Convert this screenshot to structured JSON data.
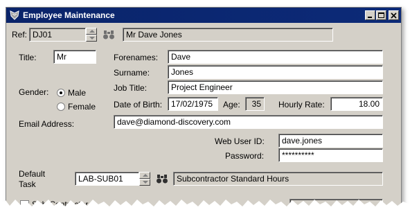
{
  "window": {
    "title": "Employee Maintenance"
  },
  "ref": {
    "label": "Ref:",
    "code": "DJ01",
    "name": "Mr Dave Jones"
  },
  "title": {
    "label": "Title:",
    "value": "Mr"
  },
  "forenames": {
    "label": "Forenames:",
    "value": "Dave"
  },
  "surname": {
    "label": "Surname:",
    "value": "Jones"
  },
  "job_title": {
    "label": "Job Title:",
    "value": "Project Engineer"
  },
  "gender": {
    "label": "Gender:",
    "options": [
      "Male",
      "Female"
    ],
    "selected": "Male"
  },
  "dob": {
    "label": "Date of Birth:",
    "value": "17/02/1975"
  },
  "age": {
    "label": "Age:",
    "value": "35"
  },
  "hourly_rate": {
    "label": "Hourly Rate:",
    "value": "18.00"
  },
  "email": {
    "label": "Email Address:",
    "value": "dave@diamond-discovery.com"
  },
  "web_user": {
    "label": "Web User ID:",
    "value": "dave.jones"
  },
  "password": {
    "label": "Password:",
    "value": "**********"
  },
  "default_task": {
    "label_line1": "Default",
    "label_line2": "Task",
    "code": "LAB-SUB01",
    "description": "Subcontractor Standard Hours"
  },
  "subcontractor": {
    "label": "Sub-Contractor"
  },
  "colors": {
    "titlebar": "#0a246a",
    "face": "#d4d0c8"
  }
}
